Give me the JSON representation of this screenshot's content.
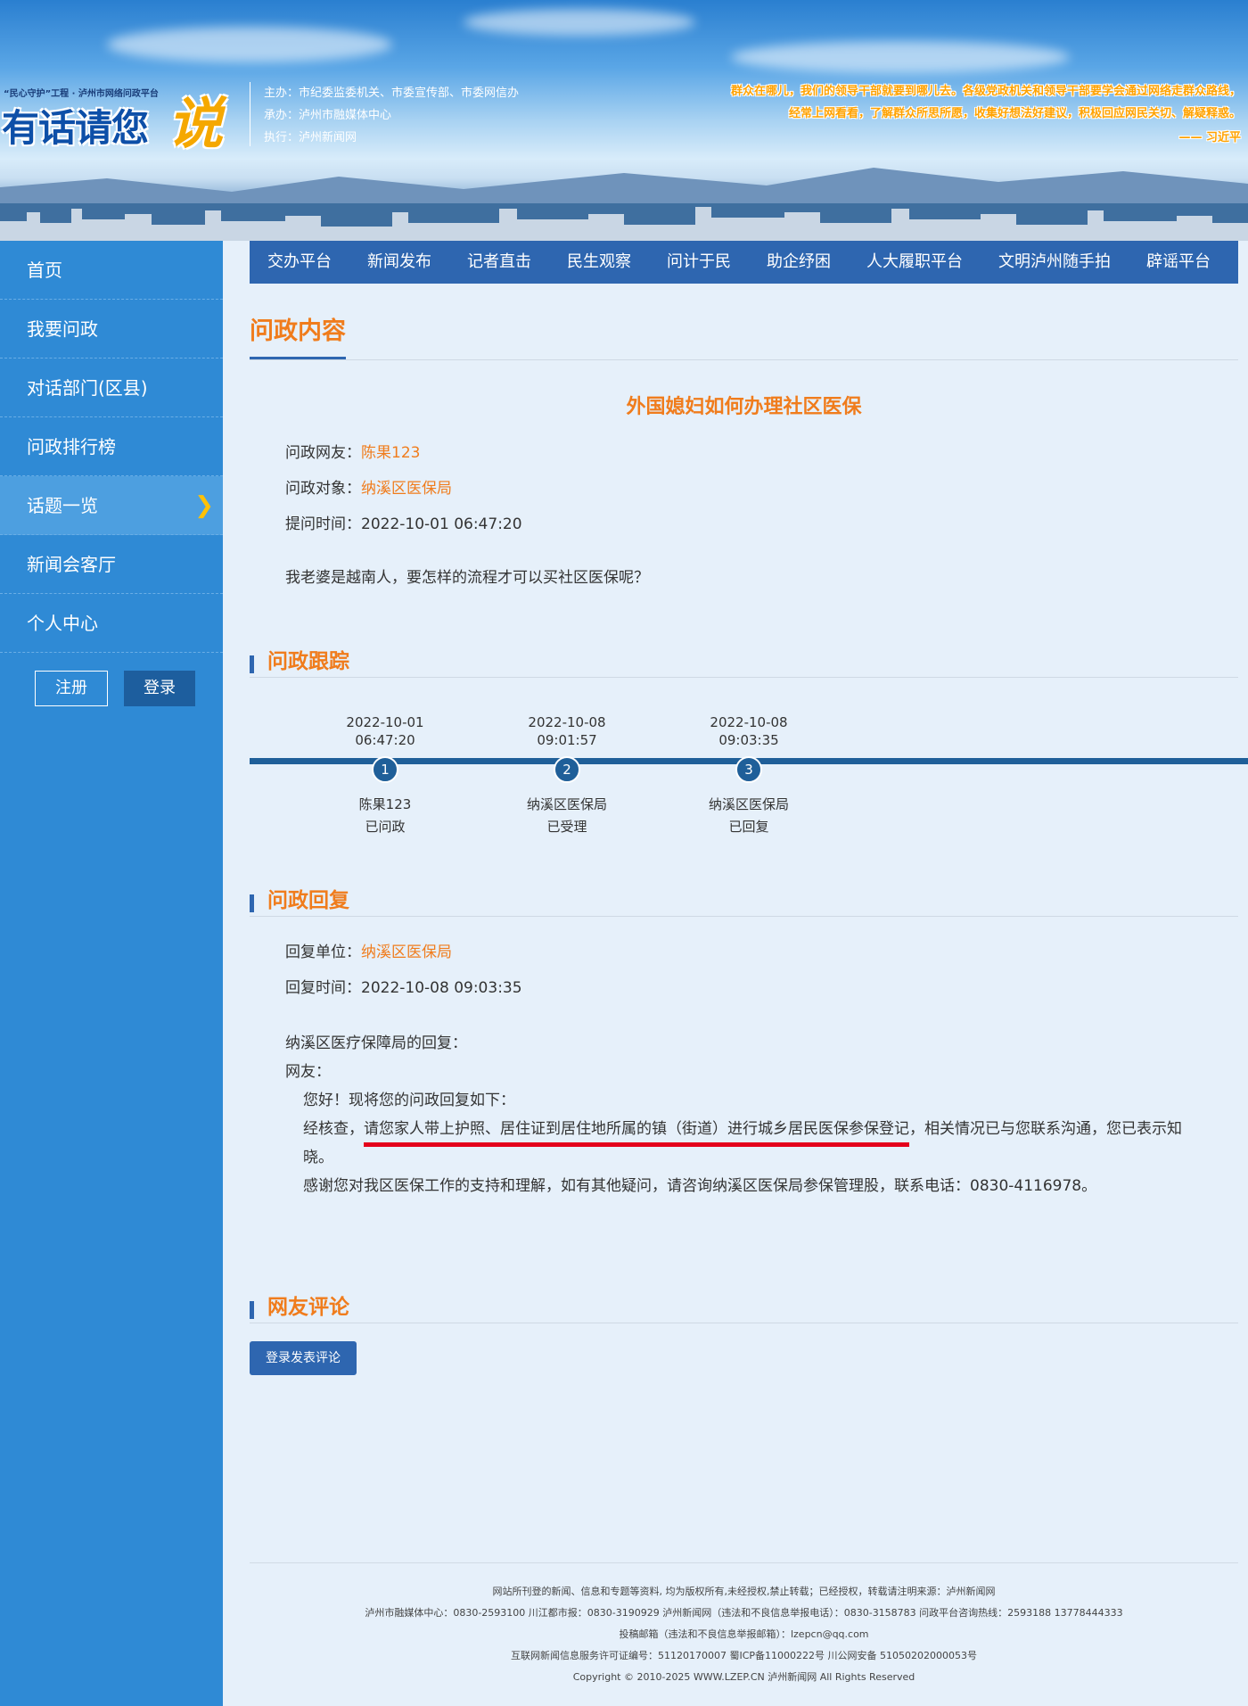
{
  "header": {
    "logo_tagline": "“民心守护”工程 · 泸州市网络问政平台",
    "logo_title": "有话请您",
    "logo_title_big": "说",
    "sponsors": [
      "主办：市纪委监委机关、市委宣传部、市委网信办",
      "承办：泸州市融媒体中心",
      "执行：泸州新闻网"
    ],
    "quote_lines": [
      "群众在哪儿，我们的领导干部就要到哪儿去。各级党政机关和领导干部要学会通过网络走群众路线，",
      "经常上网看看，了解群众所思所愿，收集好想法好建议，积极回应网民关切、解疑释惑。"
    ],
    "quote_author": "—— 习近平"
  },
  "sidebar": {
    "items": [
      {
        "label": "首页"
      },
      {
        "label": "我要问政"
      },
      {
        "label": "对话部门(区县)"
      },
      {
        "label": "问政排行榜"
      },
      {
        "label": "话题一览",
        "active": true
      },
      {
        "label": "新闻会客厅"
      },
      {
        "label": "个人中心"
      }
    ],
    "register": "注册",
    "login": "登录"
  },
  "topnav": [
    "交办平台",
    "新闻发布",
    "记者直击",
    "民生观察",
    "问计于民",
    "助企纾困",
    "人大履职平台",
    "文明泸州随手拍",
    "辟谣平台"
  ],
  "content": {
    "section_title": "问政内容",
    "question_title": "外国媳妇如何办理社区医保",
    "asker_label": "问政网友：",
    "asker": "陈果123",
    "target_label": "问政对象：",
    "target": "纳溪区医保局",
    "time_label": "提问时间：",
    "time": "2022-10-01 06:47:20",
    "question": "我老婆是越南人，要怎样的流程才可以买社区医保呢？"
  },
  "tracking": {
    "title": "问政跟踪",
    "steps": [
      {
        "date": "2022-10-01",
        "time": "06:47:20",
        "num": "1",
        "actor": "陈果123",
        "status": "已问政"
      },
      {
        "date": "2022-10-08",
        "time": "09:01:57",
        "num": "2",
        "actor": "纳溪区医保局",
        "status": "已受理"
      },
      {
        "date": "2022-10-08",
        "time": "09:03:35",
        "num": "3",
        "actor": "纳溪区医保局",
        "status": "已回复"
      }
    ]
  },
  "reply": {
    "title": "问政回复",
    "unit_label": "回复单位：",
    "unit": "纳溪区医保局",
    "time_label": "回复时间：",
    "time": "2022-10-08 09:03:35",
    "line1": "纳溪区医疗保障局的回复：",
    "line2": "网友：",
    "line3": "您好！现将您的问政回复如下：",
    "line4_pre": "经核查，",
    "line4_highlight": "请您家人带上护照、居住证到居住地所属的镇（街道）进行城乡居民医保参保登记",
    "line4_post": "，相关情况已与您联系沟通，您已表示知晓。",
    "line5": "感谢您对我区医保工作的支持和理解，如有其他疑问，请咨询纳溪区医保局参保管理股，联系电话：0830-4116978。"
  },
  "comments": {
    "title": "网友评论",
    "button": "登录发表评论"
  },
  "footer": [
    "网站所刊登的新闻、信息和专题等资料, 均为版权所有,未经授权,禁止转载；已经授权，转载请注明来源：泸州新闻网",
    "泸州市融媒体中心：0830-2593100 川江都市报：0830-3190929 泸州新闻网（违法和不良信息举报电话）：0830-3158783  问政平台咨询热线：2593188 13778444333",
    "投稿邮箱（违法和不良信息举报邮箱）：lzepcn@qq.com",
    "互联网新闻信息服务许可证编号：51120170007 蜀ICP备11000222号 川公网安备 51050202000053号",
    "Copyright © 2010-2025 WWW.LZEP.CN 泸州新闻网 All Rights Reserved"
  ]
}
